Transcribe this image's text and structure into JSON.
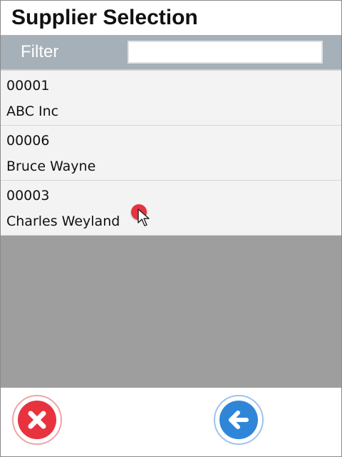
{
  "title": "Supplier Selection",
  "filter": {
    "label": "Filter",
    "value": "",
    "placeholder": ""
  },
  "suppliers": [
    {
      "code": "00001",
      "name": "ABC Inc"
    },
    {
      "code": "00006",
      "name": "Bruce Wayne"
    },
    {
      "code": "00003",
      "name": "Charles Weyland"
    }
  ],
  "buttons": {
    "cancel_icon": "close-icon",
    "back_icon": "arrow-left-icon"
  },
  "colors": {
    "filter_bar": "#a5b0b8",
    "cancel": "#e8333f",
    "back": "#2f86d9",
    "list_empty": "#9e9e9e"
  }
}
